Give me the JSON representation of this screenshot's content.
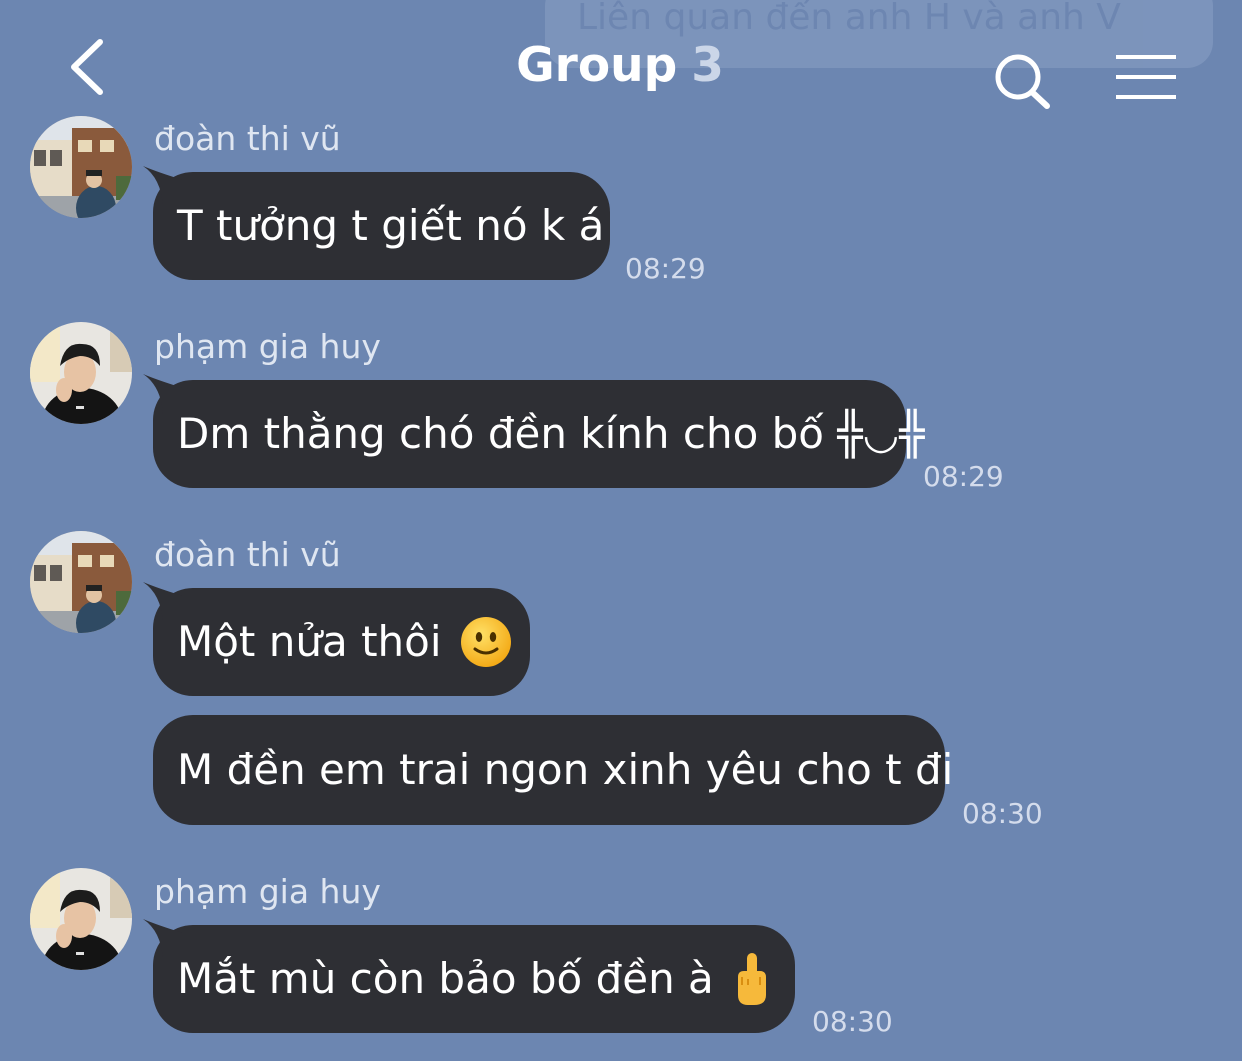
{
  "header": {
    "title": "Group",
    "member_count": "3",
    "pinned_preview": "Liên quan đến anh H và anh V"
  },
  "icons": {
    "back": "chevron-left-icon",
    "search": "search-icon",
    "menu": "hamburger-menu-icon"
  },
  "colors": {
    "background": "#6c86b1",
    "bubble": "#2e2f34",
    "bubble_text": "#ffffff",
    "sender_text": "#dfe6f1",
    "time_text": "#d4dcec"
  },
  "messages": [
    {
      "sender": "đoàn thi vũ",
      "text": "T tưởng t giết nó k á",
      "time": "08:29"
    },
    {
      "sender": "phạm gia huy",
      "text": "Dm thằng chó đền kính cho bố ╬◡╬",
      "time": "08:29"
    },
    {
      "sender": "đoàn thi vũ",
      "text": "Một nửa thôi",
      "emoji": "slightly-smiling-face-icon",
      "time": ""
    },
    {
      "sender": "",
      "text": "M đền em trai ngon xinh yêu cho t đi",
      "time": "08:30"
    },
    {
      "sender": "phạm gia huy",
      "text": "Mắt mù còn bảo bố đền à",
      "emoji": "middle-finger-icon",
      "time": "08:30"
    }
  ]
}
